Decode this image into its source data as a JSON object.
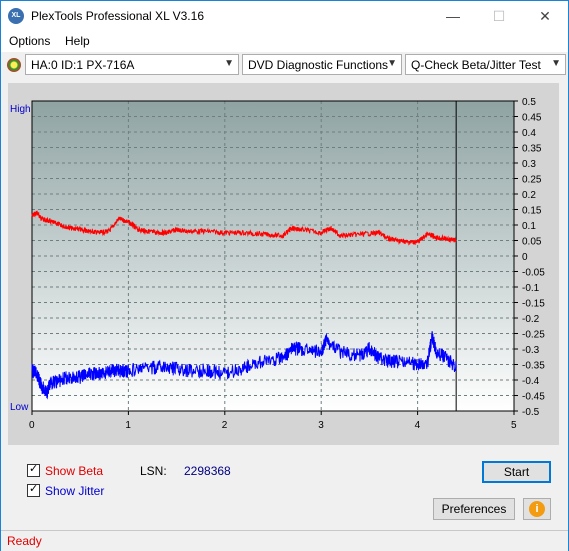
{
  "window": {
    "title": "PlexTools Professional XL V3.16",
    "icon": "xl-app-icon"
  },
  "titlebar_buttons": {
    "minimize": "—",
    "maximize": "☐",
    "close": "✕"
  },
  "menu": {
    "items": [
      {
        "label": "Options"
      },
      {
        "label": "Help"
      }
    ]
  },
  "toolbar": {
    "drive": "HA:0 ID:1  PX-716A",
    "function": "DVD Diagnostic Functions",
    "test": "Q-Check Beta/Jitter Test"
  },
  "chart_data": {
    "type": "line",
    "left_axis": {
      "top_label": "High",
      "bottom_label": "Low"
    },
    "x_ticks": [
      "0",
      "1",
      "2",
      "3",
      "4",
      "5"
    ],
    "xlim": [
      0,
      5
    ],
    "ylim": [
      -0.5,
      0.5
    ],
    "y_ticks": [
      "0.5",
      "0.45",
      "0.4",
      "0.35",
      "0.3",
      "0.25",
      "0.2",
      "0.15",
      "0.1",
      "0.05",
      "0",
      "-0.05",
      "-0.1",
      "-0.15",
      "-0.2",
      "-0.25",
      "-0.3",
      "-0.35",
      "-0.4",
      "-0.45",
      "-0.5"
    ],
    "grid": true,
    "end_marker_x": 4.4,
    "colors": {
      "beta": "#ff0000",
      "jitter": "#0000ff"
    },
    "series": [
      {
        "name": "Beta",
        "x": [
          0,
          0.05,
          0.1,
          0.2,
          0.3,
          0.4,
          0.5,
          0.6,
          0.7,
          0.8,
          0.9,
          1.0,
          1.1,
          1.2,
          1.3,
          1.4,
          1.5,
          1.6,
          1.8,
          2.0,
          2.2,
          2.4,
          2.6,
          2.7,
          2.8,
          3.0,
          3.1,
          3.2,
          3.4,
          3.6,
          3.7,
          3.8,
          3.9,
          4.0,
          4.1,
          4.2,
          4.3,
          4.4
        ],
        "values": [
          0.13,
          0.14,
          0.12,
          0.11,
          0.1,
          0.09,
          0.085,
          0.08,
          0.075,
          0.08,
          0.12,
          0.11,
          0.085,
          0.08,
          0.075,
          0.075,
          0.085,
          0.08,
          0.08,
          0.075,
          0.075,
          0.07,
          0.065,
          0.09,
          0.085,
          0.075,
          0.09,
          0.065,
          0.07,
          0.075,
          0.055,
          0.05,
          0.045,
          0.045,
          0.07,
          0.06,
          0.055,
          0.05
        ]
      },
      {
        "name": "Jitter",
        "x": [
          0,
          0.05,
          0.1,
          0.15,
          0.2,
          0.3,
          0.4,
          0.5,
          0.6,
          0.7,
          0.8,
          0.9,
          1.0,
          1.2,
          1.4,
          1.6,
          1.8,
          2.0,
          2.2,
          2.4,
          2.6,
          2.7,
          2.8,
          3.0,
          3.05,
          3.2,
          3.4,
          3.5,
          3.6,
          3.7,
          3.8,
          4.0,
          4.1,
          4.15,
          4.2,
          4.3,
          4.4
        ],
        "values": [
          -0.37,
          -0.38,
          -0.42,
          -0.44,
          -0.41,
          -0.4,
          -0.39,
          -0.39,
          -0.38,
          -0.38,
          -0.37,
          -0.37,
          -0.37,
          -0.36,
          -0.36,
          -0.37,
          -0.37,
          -0.38,
          -0.36,
          -0.34,
          -0.33,
          -0.3,
          -0.3,
          -0.31,
          -0.27,
          -0.31,
          -0.32,
          -0.3,
          -0.33,
          -0.34,
          -0.34,
          -0.35,
          -0.35,
          -0.26,
          -0.31,
          -0.33,
          -0.36
        ]
      }
    ]
  },
  "controls": {
    "show_beta": {
      "label": "Show Beta",
      "checked": true
    },
    "show_jitter": {
      "label": "Show Jitter",
      "checked": true
    },
    "lsn_label": "LSN:",
    "lsn_value": "2298368",
    "start": "Start",
    "preferences": "Preferences",
    "info_icon": "i"
  },
  "status": {
    "text": "Ready"
  }
}
